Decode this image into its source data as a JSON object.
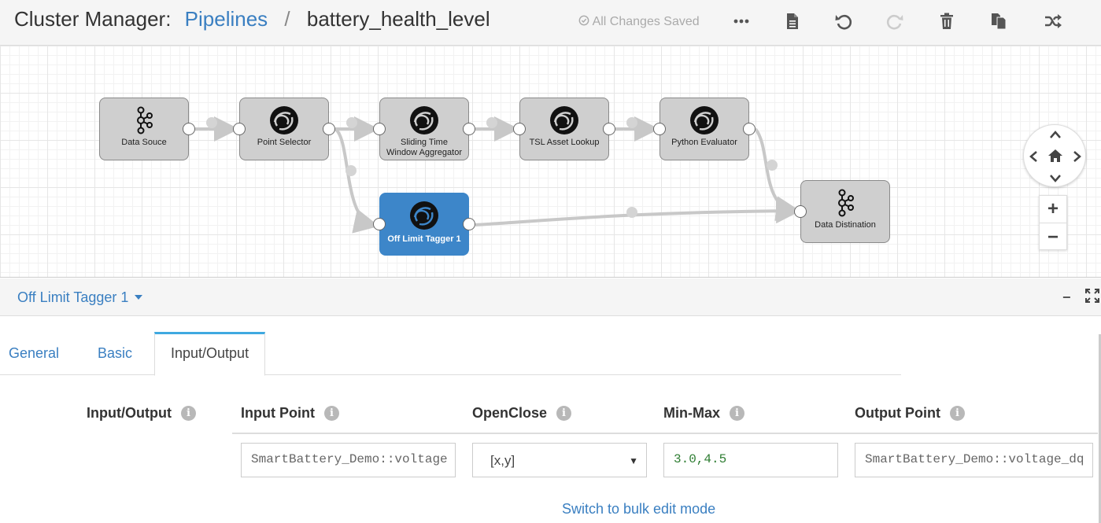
{
  "header": {
    "app_title": "Cluster Manager:",
    "crumb_pipelines": "Pipelines",
    "separator": "/",
    "pipeline_name": "battery_health_level",
    "save_status": "All Changes Saved",
    "toolbar": [
      "more-icon",
      "document-icon",
      "undo-icon",
      "redo-icon",
      "trash-icon",
      "duplicate-icon",
      "shuffle-icon"
    ]
  },
  "canvas": {
    "stages": [
      {
        "id": "data-source",
        "label": "Data Souce",
        "icon": "kafka-icon"
      },
      {
        "id": "point-selector",
        "label": "Point Selector",
        "icon": "stage-icon"
      },
      {
        "id": "sliding-window",
        "label_line1": "Sliding Time",
        "label_line2": "Window Aggregator",
        "icon": "stage-icon"
      },
      {
        "id": "tsl-asset",
        "label": "TSL Asset Lookup",
        "icon": "stage-icon"
      },
      {
        "id": "python-eval",
        "label": "Python Evaluator",
        "icon": "stage-icon"
      },
      {
        "id": "off-limit",
        "label": "Off Limit Tagger 1",
        "icon": "stage-icon",
        "selected": true
      },
      {
        "id": "data-dest",
        "label": "Data Distination",
        "icon": "kafka-icon"
      }
    ],
    "zoom_in": "+",
    "zoom_out": "−"
  },
  "panel": {
    "stage_name": "Off Limit Tagger 1",
    "minimize": "−"
  },
  "tabs": [
    {
      "label": "General",
      "active": false
    },
    {
      "label": "Basic",
      "active": false
    },
    {
      "label": "Input/Output",
      "active": true
    }
  ],
  "config": {
    "row_label": "Input/Output",
    "columns": {
      "input_point": "Input Point",
      "open_close": "OpenClose",
      "min_max": "Min-Max",
      "output_point": "Output Point"
    },
    "values": {
      "input_point": "SmartBattery_Demo::voltage",
      "open_close": "[x,y]",
      "min_max": "3.0,4.5",
      "output_point": "SmartBattery_Demo::voltage_dq"
    },
    "info_glyph": "i",
    "bulk_edit": "Switch to bulk edit mode"
  },
  "colors": {
    "accent": "#3a7fc1",
    "selected_stage": "#3d86c9",
    "stage_bg": "#cfcfcf",
    "active_tab_border": "#3fa9e0"
  }
}
